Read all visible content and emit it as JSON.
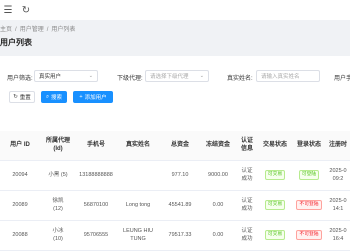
{
  "breadcrumb": [
    "主页",
    "/",
    "用户管理",
    "/",
    "用户列表"
  ],
  "page_title": "用户列表",
  "filters": {
    "user_filter": {
      "label": "用户筛选:",
      "value": "真实用户"
    },
    "agent": {
      "label": "下级代理:",
      "placeholder": "请选择下级代理"
    },
    "real_name": {
      "label": "真实姓名:",
      "placeholder": "请输入真实姓名"
    },
    "user_phone": {
      "label": "用户手"
    }
  },
  "buttons": {
    "reset": "重置",
    "search": "搜索",
    "add_user": "添加用户"
  },
  "table": {
    "headers": [
      "用户\nID",
      "所属代理\n(Id)",
      "手机号",
      "真实姓名",
      "总资金",
      "冻结资金",
      "认证\n信息",
      "交易状态",
      "登录状态",
      "注册时"
    ],
    "rows": [
      {
        "id": "20094",
        "agent": "小黑 (5)",
        "phone": "13188888888",
        "name": "",
        "total": "977.10",
        "frozen": "9000.00",
        "auth": "认证\n成功",
        "trade": "可交易",
        "login": "可登陆",
        "reg": "2025-0\n09:2"
      },
      {
        "id": "20089",
        "agent": "徐凯\n(12)",
        "phone": "56870100",
        "name": "Long tong",
        "total": "45541.89",
        "frozen": "0.00",
        "auth": "认证\n成功",
        "trade": "可交易",
        "login": "不可登陆",
        "reg": "2025-0\n14:1"
      },
      {
        "id": "20088",
        "agent": "小冰\n(10)",
        "phone": "95706555",
        "name": "LEUNG HIU\nTUNG",
        "total": "79517.33",
        "frozen": "0.00",
        "auth": "认证\n成功",
        "trade": "可交易",
        "login": "不可登陆",
        "reg": "2025-0\n16:4"
      }
    ]
  },
  "colors": {
    "primary": "#1890ff",
    "ok": "#52c41a",
    "bad": "#f5222d"
  }
}
